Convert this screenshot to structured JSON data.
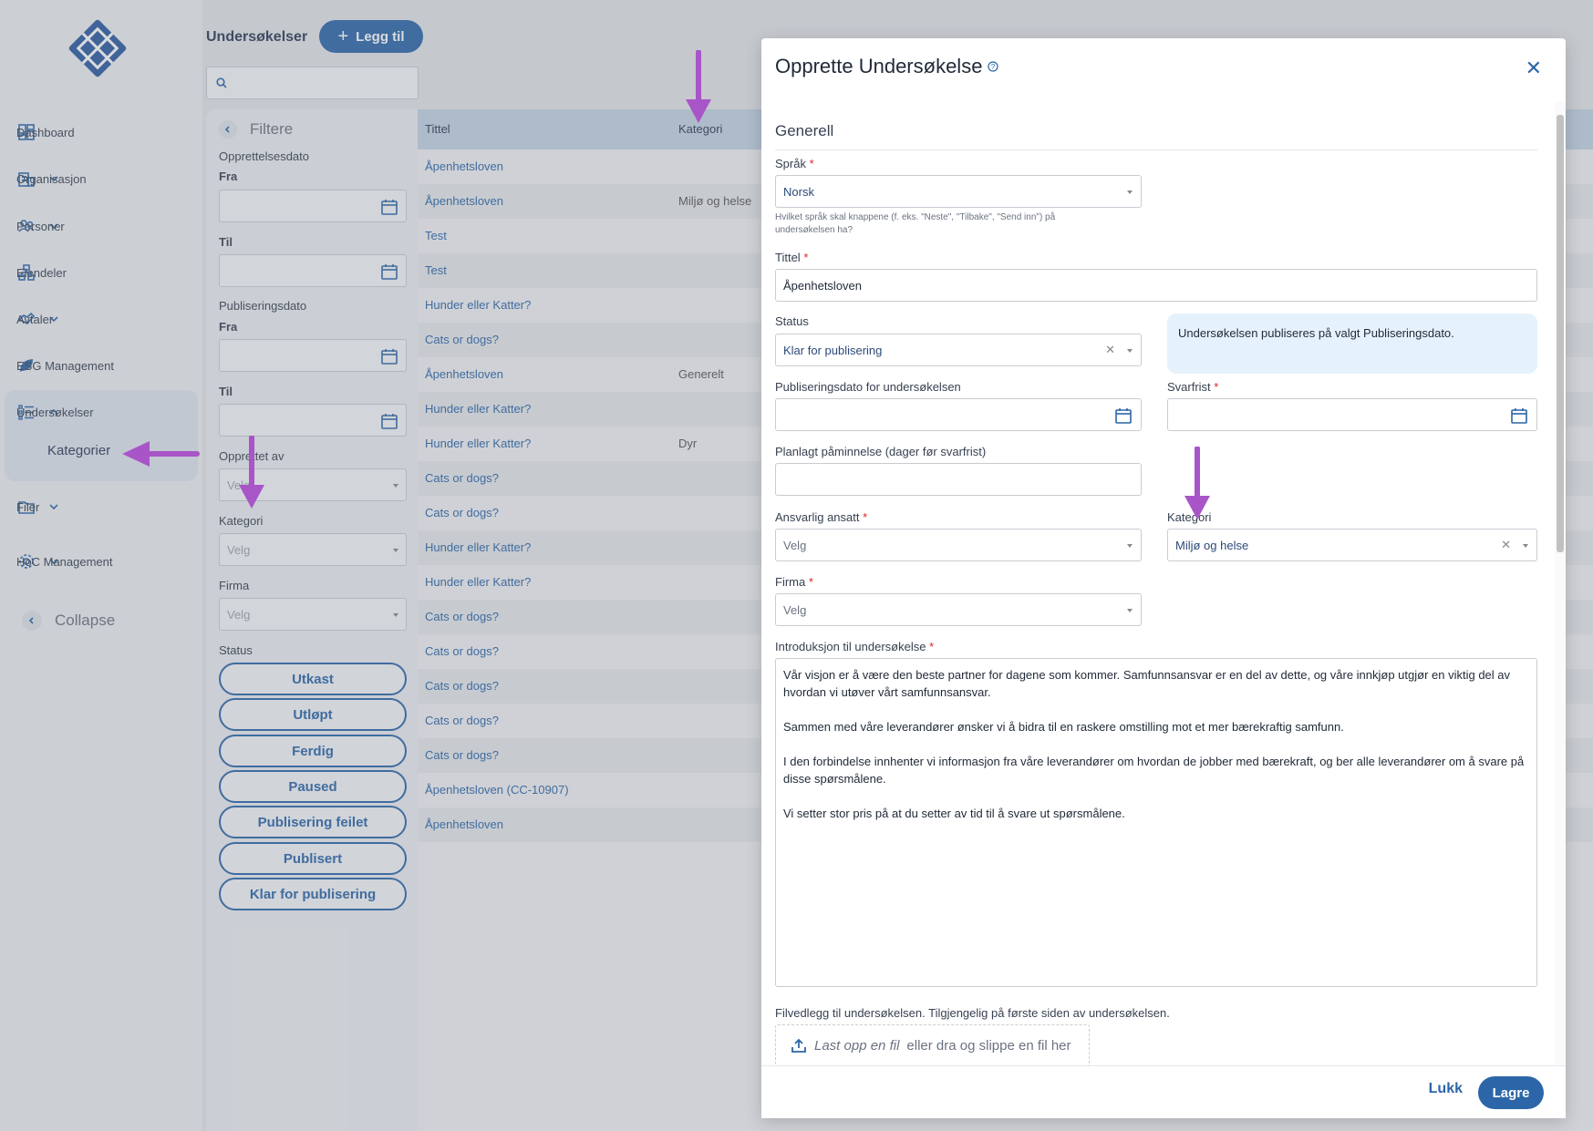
{
  "sidebar": {
    "items": [
      {
        "label": "Dashboard",
        "icon": "dashboard-icon"
      },
      {
        "label": "Organisasjon",
        "icon": "building-icon"
      },
      {
        "label": "Personer",
        "icon": "people-icon"
      },
      {
        "label": "Eiendeler",
        "icon": "assets-icon"
      },
      {
        "label": "Avtaler",
        "icon": "handshake-icon"
      },
      {
        "label": "ESG Management",
        "icon": "leaf-icon"
      },
      {
        "label": "Undersøkelser",
        "icon": "list-icon"
      },
      {
        "label": "Filer",
        "icon": "folder-icon"
      },
      {
        "label": "HoC Management",
        "icon": "gear-icon"
      }
    ],
    "sub_item": "Kategorier",
    "collapse": "Collapse"
  },
  "header": {
    "title": "Undersøkelser",
    "add_label": "Legg til"
  },
  "filters": {
    "title": "Filtere",
    "created_label": "Opprettelsesdato",
    "from": "Fra",
    "to": "Til",
    "published_label": "Publiseringsdato",
    "created_by": "Opprettet av",
    "category": "Kategori",
    "company": "Firma",
    "status": "Status",
    "select_placeholder": "Velg",
    "created_by_value": "Velg",
    "status_buttons": [
      "Utkast",
      "Utløpt",
      "Ferdig",
      "Paused",
      "Publisering feilet",
      "Publisert",
      "Klar for publisering"
    ]
  },
  "table": {
    "columns": {
      "title": "Tittel",
      "category": "Kategori"
    },
    "rows": [
      {
        "title": "Åpenhetsloven",
        "category": ""
      },
      {
        "title": "Åpenhetsloven",
        "category": "Miljø og helse"
      },
      {
        "title": "Test",
        "category": ""
      },
      {
        "title": "Test",
        "category": ""
      },
      {
        "title": "Hunder eller Katter?",
        "category": ""
      },
      {
        "title": "Cats or dogs?",
        "category": ""
      },
      {
        "title": "Åpenhetsloven",
        "category": "Generelt"
      },
      {
        "title": "Hunder eller Katter?",
        "category": ""
      },
      {
        "title": "Hunder eller Katter?",
        "category": "Dyr"
      },
      {
        "title": "Cats or dogs?",
        "category": ""
      },
      {
        "title": "Cats or dogs?",
        "category": ""
      },
      {
        "title": "Hunder eller Katter?",
        "category": ""
      },
      {
        "title": "Hunder eller Katter?",
        "category": ""
      },
      {
        "title": "Cats or dogs?",
        "category": ""
      },
      {
        "title": "Cats or dogs?",
        "category": ""
      },
      {
        "title": "Cats or dogs?",
        "category": ""
      },
      {
        "title": "Cats or dogs?",
        "category": ""
      },
      {
        "title": "Cats or dogs?",
        "category": ""
      },
      {
        "title": "Åpenhetsloven (CC-10907)",
        "category": ""
      },
      {
        "title": "Åpenhetsloven",
        "category": ""
      }
    ]
  },
  "modal": {
    "title": "Opprette Undersøkelse",
    "section": "Generell",
    "language_label": "Språk",
    "language_value": "Norsk",
    "language_hint": "Hvilket språk skal knappene (f. eks. \"Neste\", \"Tilbake\", \"Send inn\") på undersøkelsen ha?",
    "title_label": "Tittel",
    "title_value": "Åpenhetsloven",
    "status_label": "Status",
    "status_value": "Klar for publisering",
    "info_text": "Undersøkelsen publiseres på valgt Publiseringsdato.",
    "publish_date_label": "Publiseringsdato for undersøkelsen",
    "deadline_label": "Svarfrist",
    "reminder_label": "Planlagt påminnelse (dager før svarfrist)",
    "responsible_label": "Ansvarlig ansatt",
    "responsible_value": "Velg",
    "category_label": "Kategori",
    "category_value": "Miljø og helse",
    "company_label": "Firma",
    "company_value": "Velg",
    "intro_label": "Introduksjon til undersøkelse",
    "intro_paragraphs": [
      "Vår visjon er å være den beste partner for dagene som kommer. Samfunnsansvar er en del av dette, og våre innkjøp utgjør en viktig del av hvordan vi utøver vårt samfunnsansvar.",
      "Sammen med våre leverandører ønsker vi å bidra til en raskere omstilling mot et mer bærekraftig samfunn.",
      "I den forbindelse innhenter vi informasjon fra våre leverandører om hvordan de jobber med bærekraft, og ber alle leverandører om å svare på disse spørsmålene.",
      "Vi setter stor pris på at du setter av tid til å svare ut spørsmålene."
    ],
    "attachment_label": "Filvedlegg til undersøkelsen. Tilgjengelig på første siden av undersøkelsen.",
    "upload_link": "Last opp en fil",
    "upload_rest": "eller dra og slippe en fil her",
    "close_label": "Lukk",
    "save_label": "Lagre",
    "required_mark": "*"
  },
  "colors": {
    "primary": "#2c66a8",
    "annotation": "#a855c8",
    "required": "#dc2626"
  }
}
